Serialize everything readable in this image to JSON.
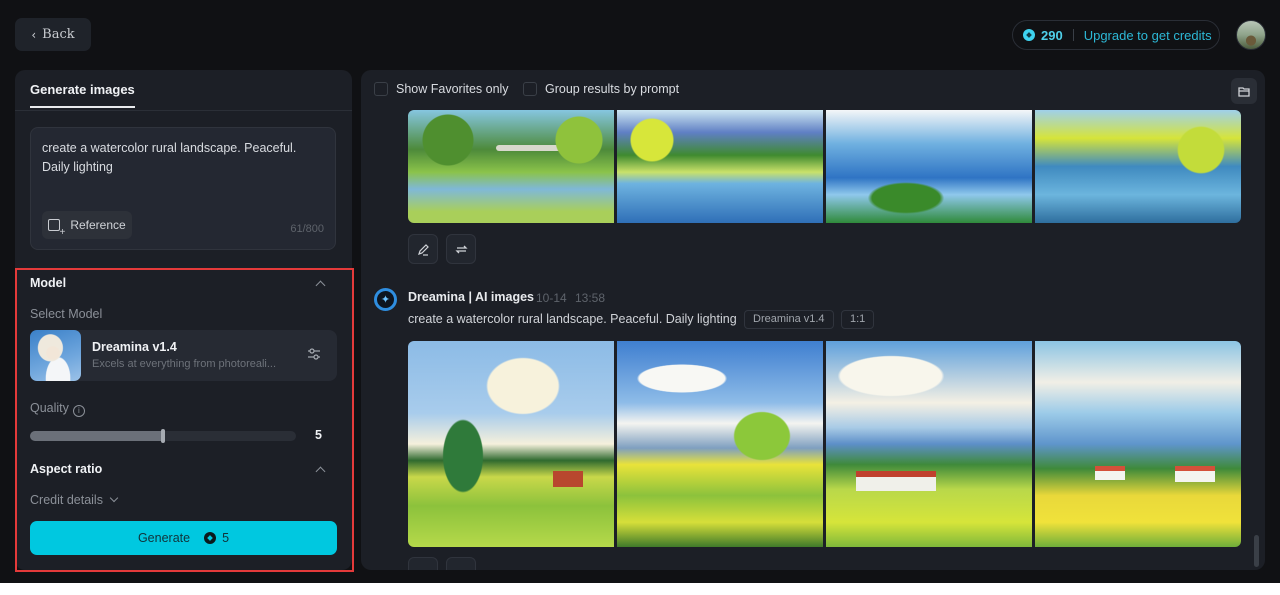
{
  "topbar": {
    "back_label": "Back",
    "credits": "290",
    "upgrade_label": "Upgrade to get credits"
  },
  "left_panel": {
    "tab_label": "Generate images",
    "prompt_value": "create a watercolor rural landscape. Peaceful. Daily lighting",
    "reference_label": "Reference",
    "char_count": "61/800",
    "model_section": {
      "title": "Model",
      "select_label": "Select Model",
      "model_name": "Dreamina v1.4",
      "model_desc": "Excels at everything from photoreali..."
    },
    "quality": {
      "label": "Quality",
      "value": "5",
      "fraction": 0.5
    },
    "aspect_ratio_label": "Aspect ratio",
    "credit_details_label": "Credit details",
    "generate_label": "Generate",
    "generate_cost": "5"
  },
  "right_panel": {
    "show_favorites_label": "Show Favorites only",
    "group_results_label": "Group results by prompt",
    "generation": {
      "title": "Dreamina | AI images",
      "date": "10-14",
      "time": "13:58",
      "prompt": "create a watercolor rural landscape. Peaceful. Daily lighting",
      "model_tag": "Dreamina v1.4",
      "ratio_tag": "1:1"
    },
    "top_row_images": [
      "river-bridge-watercolor",
      "river-mountains-watercolor",
      "lake-wildflowers-watercolor",
      "river-reflection-watercolor"
    ],
    "bottom_row_images": [
      "farm-tree-clouds-watercolor",
      "meadow-tree-houses-watercolor",
      "village-hills-watercolor",
      "flower-field-village-watercolor"
    ]
  },
  "colors": {
    "accent": "#00c8e0",
    "credit_text": "#2db8d6",
    "highlight_border": "#e43a3a",
    "panel_bg": "#1c1f26",
    "page_bg": "#101114"
  }
}
